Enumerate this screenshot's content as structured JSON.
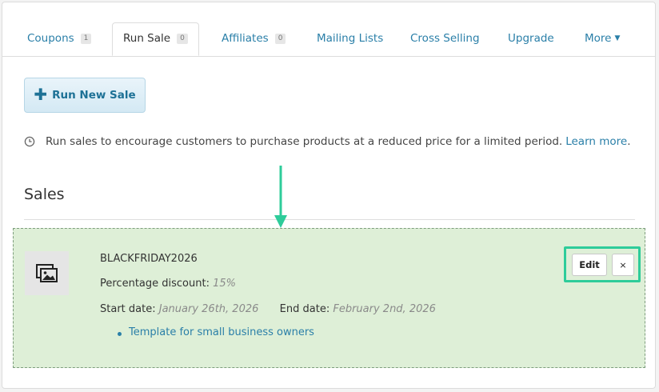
{
  "tabs": [
    {
      "label": "Coupons",
      "badge": "1"
    },
    {
      "label": "Run Sale",
      "badge": "0",
      "active": true
    },
    {
      "label": "Affiliates",
      "badge": "0"
    },
    {
      "label": "Mailing Lists"
    },
    {
      "label": "Cross Selling"
    },
    {
      "label": "Upgrade"
    },
    {
      "label": "More"
    }
  ],
  "run_button": {
    "label": "Run New Sale"
  },
  "info": {
    "text": "Run sales to encourage customers to purchase products at a reduced price for a limited period.",
    "link": "Learn more",
    "trailing": "."
  },
  "section": {
    "title": "Sales"
  },
  "sale": {
    "name": "BLACKFRIDAY2026",
    "discount_label": "Percentage discount:",
    "discount_value": "15%",
    "start_label": "Start date:",
    "start_value": "January 26th, 2026",
    "end_label": "End date:",
    "end_value": "February 2nd, 2026",
    "template_link": "Template for small business owners",
    "edit_label": "Edit",
    "delete_label": "×"
  },
  "colors": {
    "link": "#2a7fa8",
    "highlight": "#2ecc9a",
    "card_bg": "#deefd7"
  }
}
